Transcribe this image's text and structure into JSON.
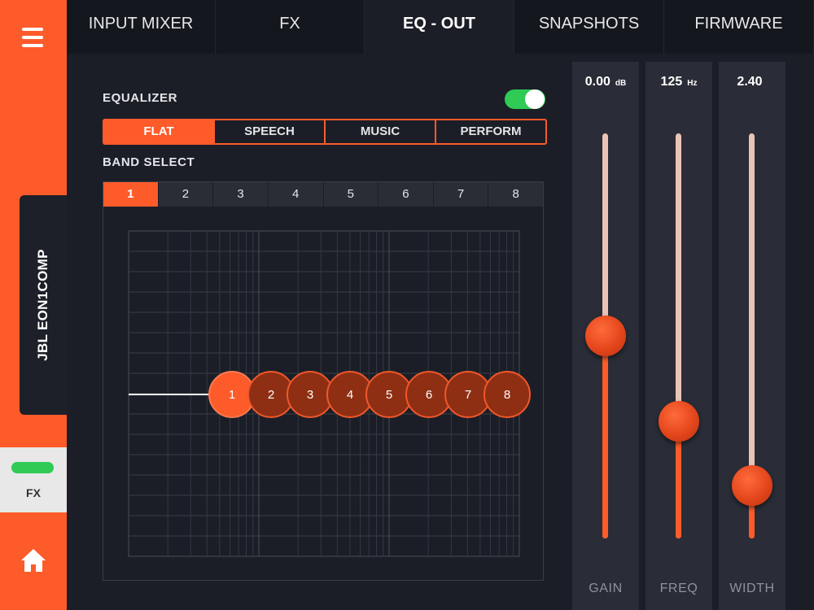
{
  "sidebar": {
    "device_name": "JBL EON1COMP",
    "fx_button_label": "FX",
    "icons": {
      "menu": "hamburger-icon",
      "home": "home-icon"
    }
  },
  "tabs": [
    {
      "label": "INPUT MIXER",
      "active": false
    },
    {
      "label": "FX",
      "active": false
    },
    {
      "label": "EQ - OUT",
      "active": true
    },
    {
      "label": "SNAPSHOTS",
      "active": false
    },
    {
      "label": "FIRMWARE",
      "active": false
    }
  ],
  "equalizer": {
    "title": "EQUALIZER",
    "enabled": true,
    "presets": [
      {
        "label": "FLAT",
        "active": true
      },
      {
        "label": "SPEECH",
        "active": false
      },
      {
        "label": "MUSIC",
        "active": false
      },
      {
        "label": "PERFORM",
        "active": false
      }
    ],
    "band_select_title": "BAND SELECT",
    "bands": [
      {
        "label": "1",
        "active": true
      },
      {
        "label": "2",
        "active": false
      },
      {
        "label": "3",
        "active": false
      },
      {
        "label": "4",
        "active": false
      },
      {
        "label": "5",
        "active": false
      },
      {
        "label": "6",
        "active": false
      },
      {
        "label": "7",
        "active": false
      },
      {
        "label": "8",
        "active": false
      }
    ],
    "nodes": [
      "1",
      "2",
      "3",
      "4",
      "5",
      "6",
      "7",
      "8"
    ]
  },
  "sliders": {
    "gain": {
      "value": "0.00",
      "unit": "dB",
      "label": "GAIN",
      "level": 0.5
    },
    "freq": {
      "value": "125",
      "unit": "Hz",
      "label": "FREQ",
      "level": 0.29
    },
    "width": {
      "value": "2.40",
      "unit": "",
      "label": "WIDTH",
      "level": 0.13
    }
  },
  "colors": {
    "accent": "#fd5b2a",
    "toggle_on": "#2fcb55",
    "background": "#1b1e27",
    "panel": "#2a2d37"
  }
}
